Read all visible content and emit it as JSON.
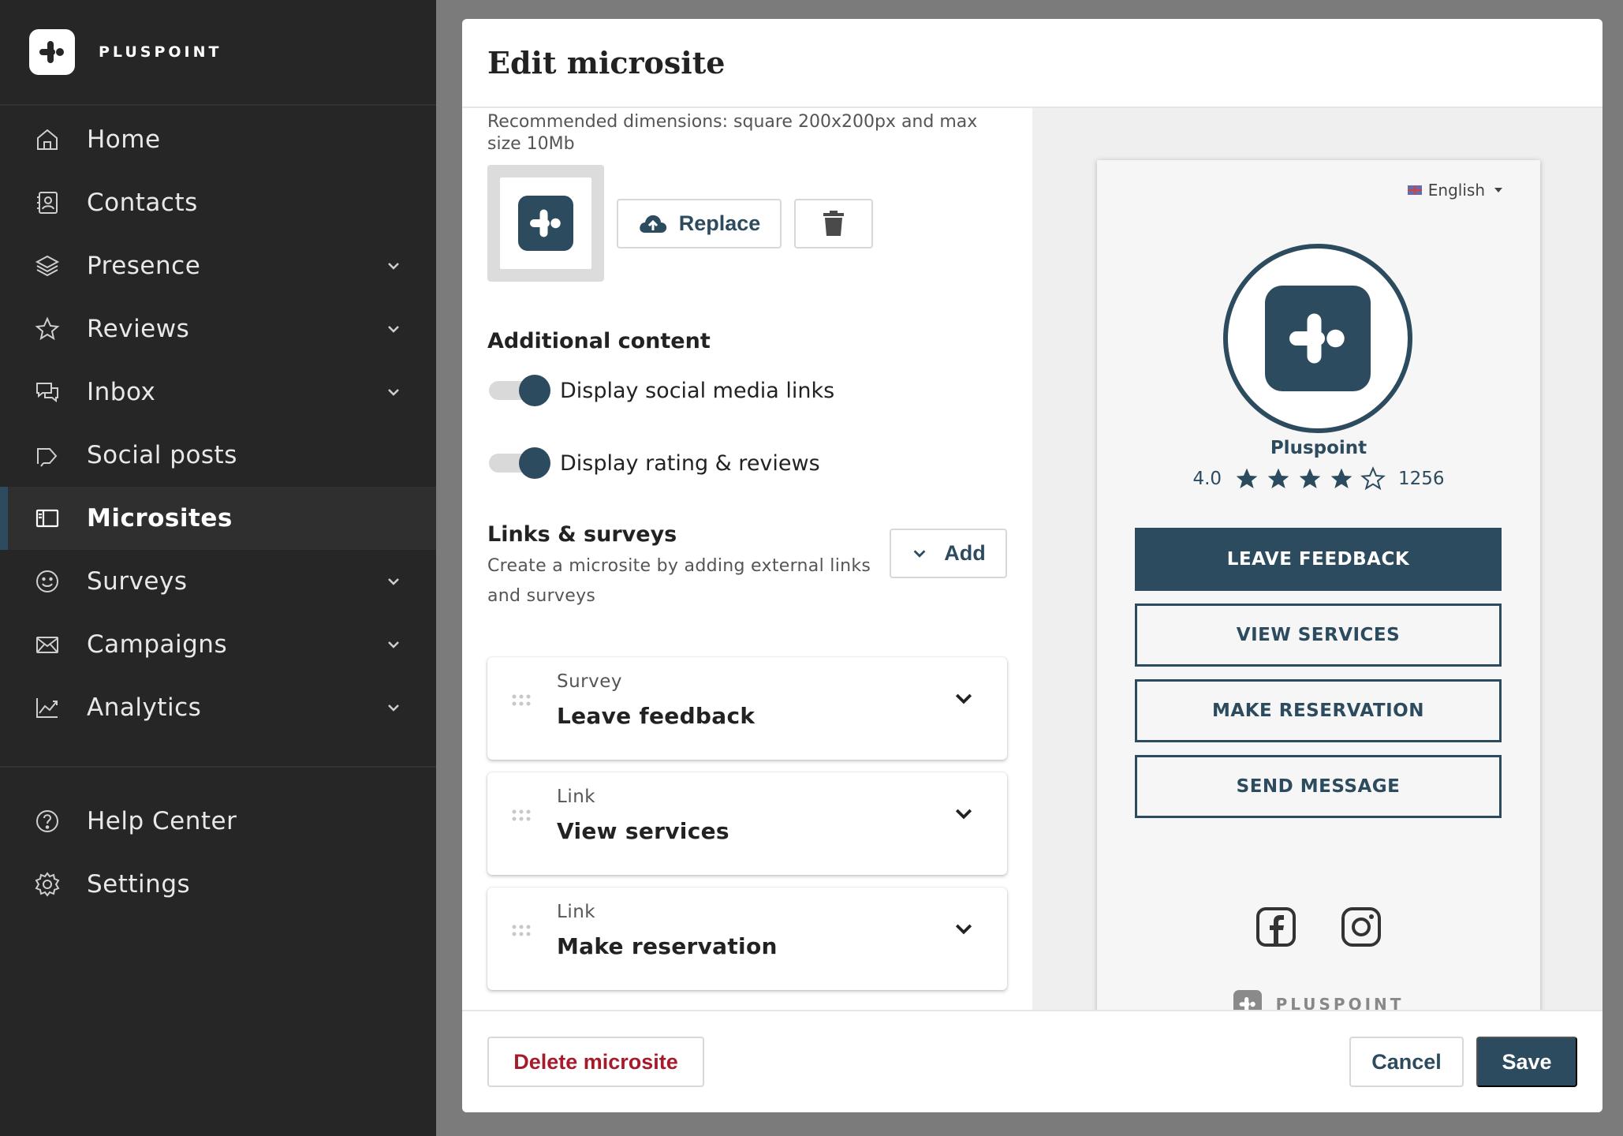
{
  "brand": {
    "name": "PLUSPOINT"
  },
  "colors": {
    "accent": "#2c4b5e",
    "danger": "#a61b2b",
    "sidebar": "#262626"
  },
  "nav": {
    "items": [
      {
        "label": "Home",
        "icon": "home-icon",
        "expandable": false
      },
      {
        "label": "Contacts",
        "icon": "contacts-icon",
        "expandable": false
      },
      {
        "label": "Presence",
        "icon": "layers-icon",
        "expandable": true
      },
      {
        "label": "Reviews",
        "icon": "star-icon",
        "expandable": true
      },
      {
        "label": "Inbox",
        "icon": "chat-icon",
        "expandable": true
      },
      {
        "label": "Social posts",
        "icon": "megaphone-icon",
        "expandable": false
      },
      {
        "label": "Microsites",
        "icon": "microsite-icon",
        "expandable": false,
        "active": true
      },
      {
        "label": "Surveys",
        "icon": "smiley-icon",
        "expandable": true
      },
      {
        "label": "Campaigns",
        "icon": "mail-icon",
        "expandable": true
      },
      {
        "label": "Analytics",
        "icon": "chart-icon",
        "expandable": true
      }
    ],
    "secondary": [
      {
        "label": "Help Center",
        "icon": "help-icon"
      },
      {
        "label": "Settings",
        "icon": "gear-icon"
      }
    ]
  },
  "modal": {
    "title": "Edit microsite",
    "logo_hint": "Recommended dimensions: square 200x200px and max size 10Mb",
    "replace_label": "Replace",
    "additional_title": "Additional content",
    "toggles": [
      {
        "label": "Display social media links",
        "on": true
      },
      {
        "label": "Display rating & reviews",
        "on": true
      }
    ],
    "links_title": "Links & surveys",
    "links_desc": "Create a microsite by adding external links and surveys",
    "add_label": "Add",
    "cards": [
      {
        "type": "Survey",
        "name": "Leave feedback"
      },
      {
        "type": "Link",
        "name": "View services"
      },
      {
        "type": "Link",
        "name": "Make reservation"
      }
    ],
    "delete_label": "Delete microsite",
    "cancel_label": "Cancel",
    "save_label": "Save"
  },
  "preview": {
    "language": "English",
    "business_name": "Pluspoint",
    "rating": "4.0",
    "stars_filled": 4,
    "stars_total": 5,
    "review_count": "1256",
    "buttons": [
      "LEAVE FEEDBACK",
      "VIEW SERVICES",
      "MAKE RESERVATION",
      "SEND MESSAGE"
    ],
    "socials": [
      "facebook-icon",
      "instagram-icon"
    ],
    "footer_brand": "PLUSPOINT"
  }
}
